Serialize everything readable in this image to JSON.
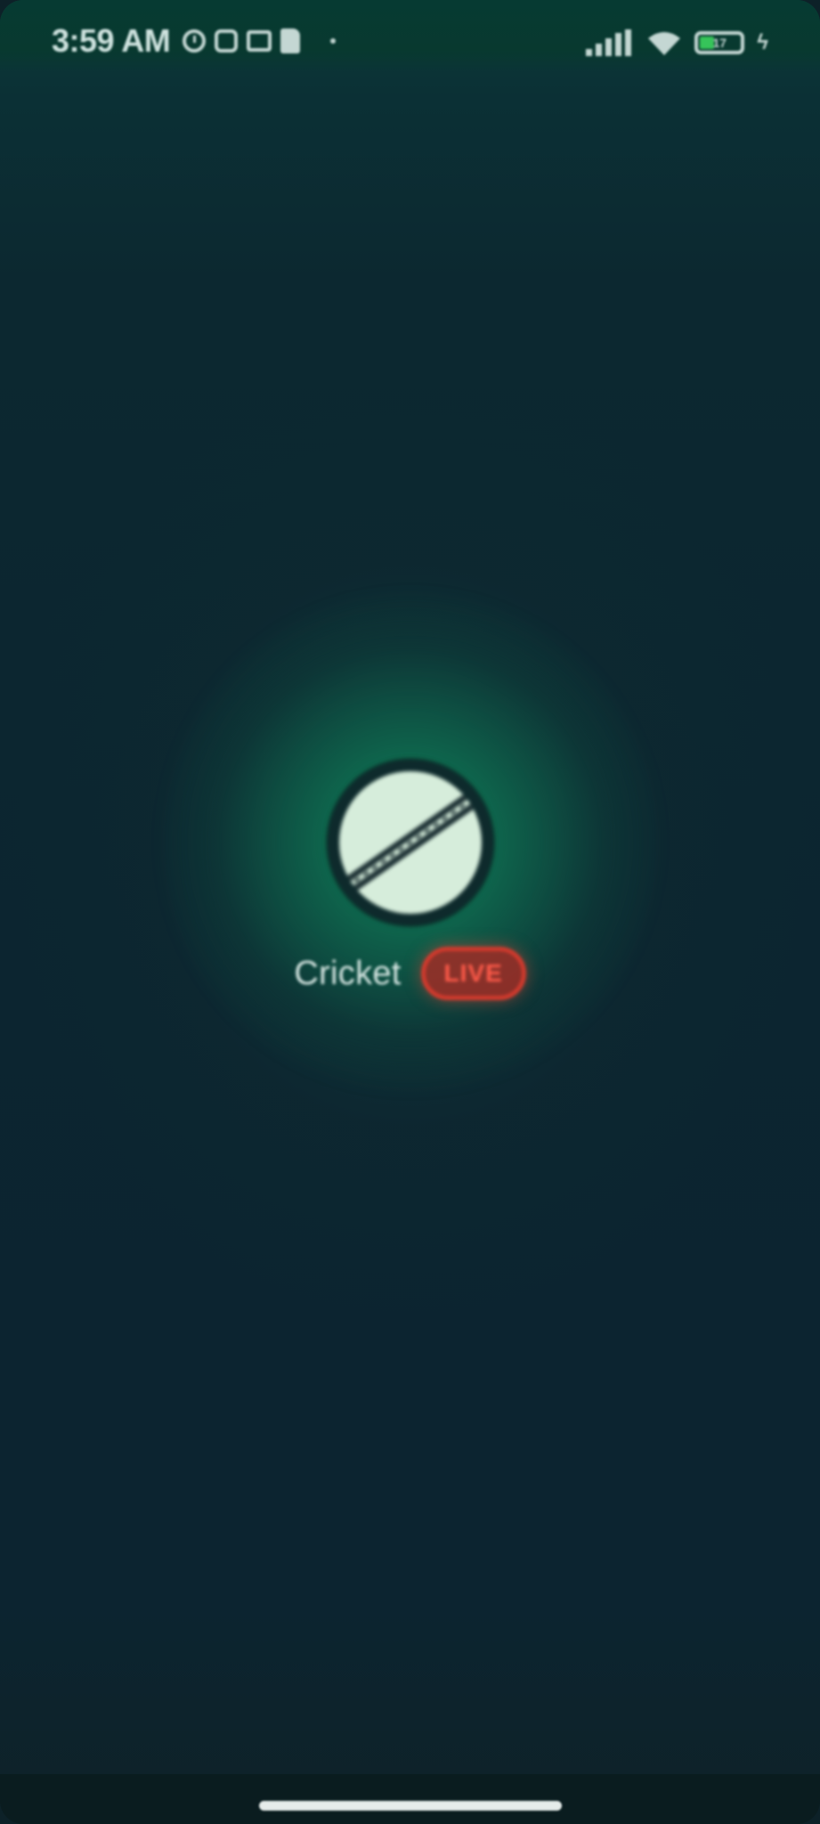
{
  "status_bar": {
    "time": "3:59 AM",
    "battery_level": "17",
    "icons": [
      "alarm-icon",
      "instagram-icon",
      "card-icon",
      "sim-icon",
      "dot-icon",
      "signal-icon",
      "wifi-icon",
      "battery-icon",
      "charging-icon"
    ]
  },
  "splash": {
    "sport_icon": "cricket-ball-icon",
    "sport_name": "Cricket",
    "badge": "LIVE"
  },
  "colors": {
    "background": "#0c2530",
    "glow": "#108c5f",
    "ball": "#d6eddb",
    "live": "#d23a2d"
  },
  "nav": {
    "home_indicator": "home-indicator"
  }
}
